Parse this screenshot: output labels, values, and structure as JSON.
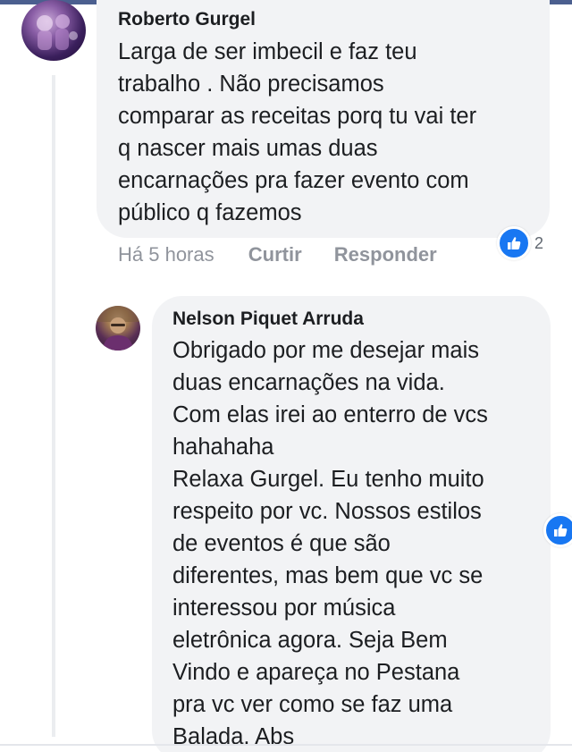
{
  "comments": [
    {
      "author": "Roberto Gurgel",
      "text_lines": [
        "Larga de ser imbecil e faz teu",
        "trabalho . Não precisamos",
        "comparar as receitas porq tu vai ter",
        "q nascer mais umas duas",
        "encarnações pra fazer evento com",
        "público q fazemos"
      ],
      "timestamp": "Há 5 horas",
      "like_label": "Curtir",
      "reply_label": "Responder",
      "reaction_icon": "like-icon",
      "reaction_count": "2"
    },
    {
      "author": "Nelson Piquet Arruda",
      "text_lines": [
        "Obrigado por me desejar mais",
        "duas encarnações na vida.",
        "Com elas irei ao enterro de vcs",
        "hahahaha",
        "Relaxa Gurgel. Eu tenho muito",
        "respeito por vc. Nossos estilos",
        "de eventos é que são",
        "diferentes, mas bem que vc se",
        "interessou por música",
        "eletrônica agora. Seja Bem",
        "Vindo e apareça no Pestana",
        "pra vc ver como se faz uma",
        "Balada. Abs"
      ],
      "reaction_icon": "like-icon"
    }
  ],
  "colors": {
    "bubble": "#f2f3f5",
    "text": "#1c1e21",
    "meta": "#90949c",
    "like_blue": "#1877f2"
  }
}
